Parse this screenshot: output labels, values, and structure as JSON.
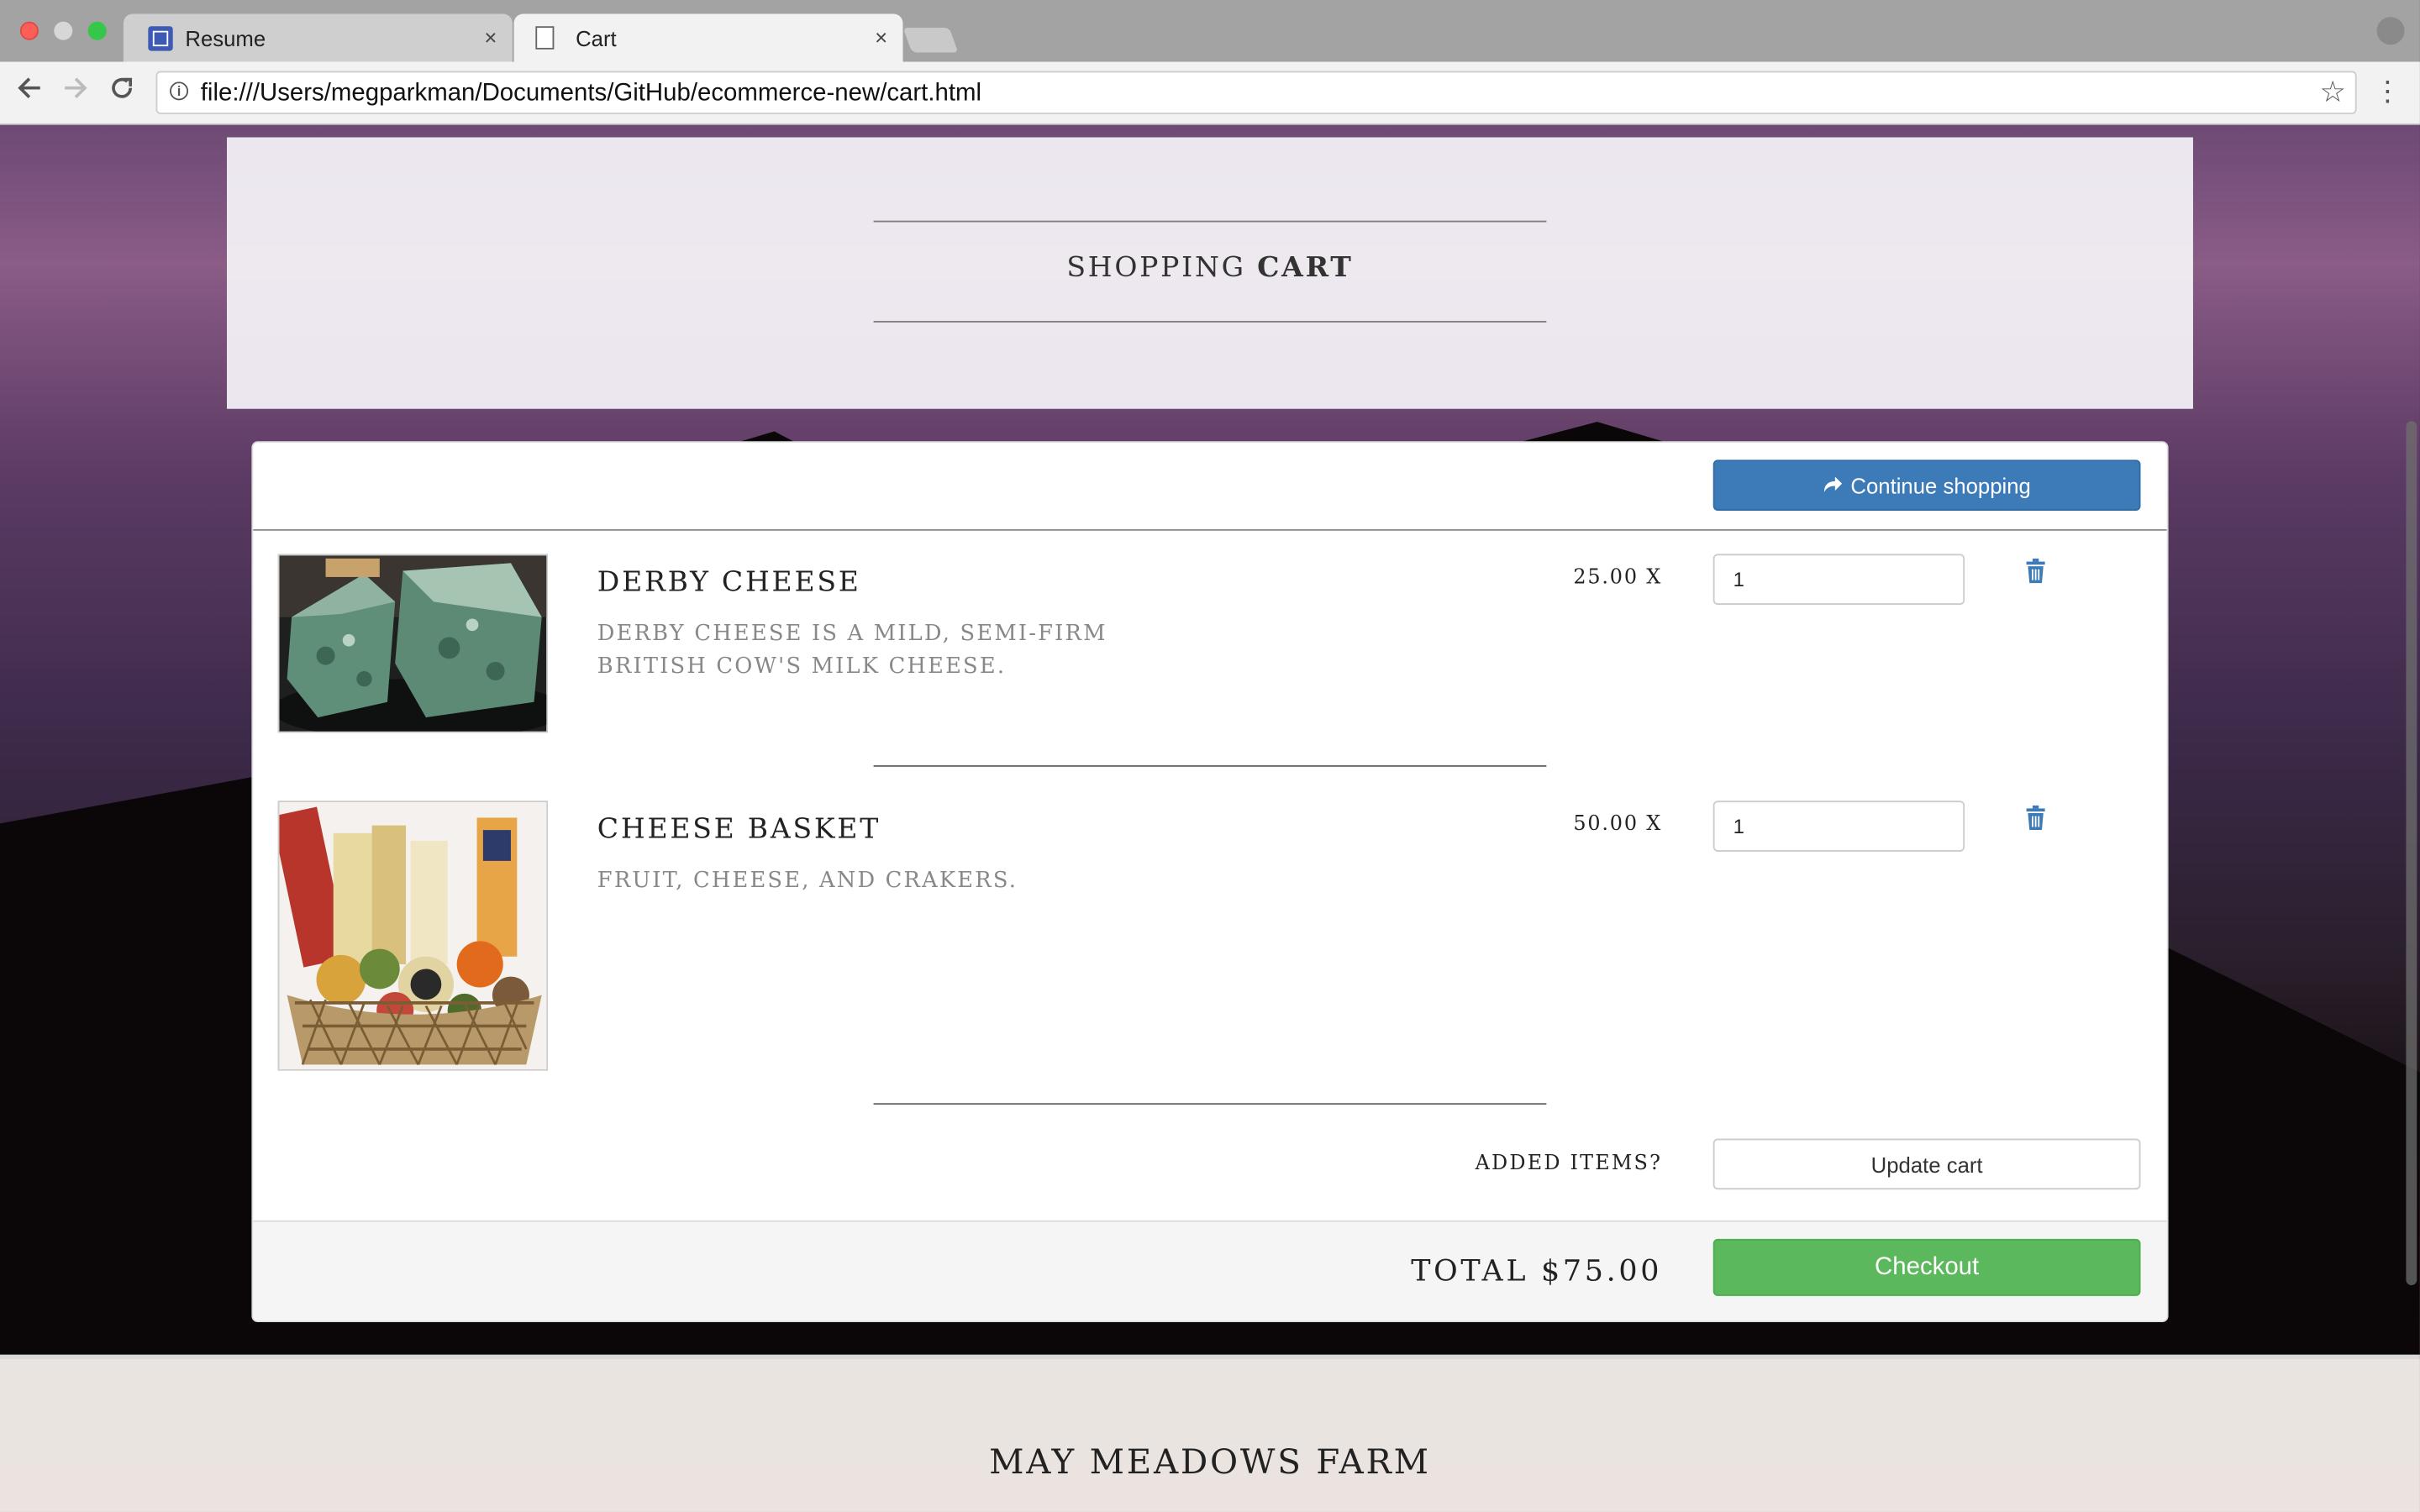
{
  "browser": {
    "tabs": [
      {
        "title": "Resume",
        "active": false
      },
      {
        "title": "Cart",
        "active": true
      }
    ],
    "tab_close_glyph": "×",
    "url": "file:///Users/megparkman/Documents/GitHub/ecommerce-new/cart.html"
  },
  "header": {
    "title_light": "SHOPPING ",
    "title_bold": "CART"
  },
  "cart": {
    "continue_label": "Continue shopping",
    "items": [
      {
        "name": "DERBY CHEESE",
        "description": "Derby cheese is a mild, semi-firm British cow's milk cheese.",
        "price": "25.00 X",
        "quantity": "1",
        "image": "derby-cheese-photo"
      },
      {
        "name": "CHEESE BASKET",
        "description": "Fruit, cheese, and crakers.",
        "price": "50.00 X",
        "quantity": "1",
        "image": "cheese-basket-photo"
      }
    ],
    "added_items_label": "ADDED ITEMS?",
    "update_label": "Update cart",
    "total_label": "TOTAL $75.00",
    "checkout_label": "Checkout"
  },
  "footer": {
    "title": "MAY MEADOWS FARM"
  },
  "colors": {
    "continue_button": "#3d7ab8",
    "checkout_button": "#5cb85c",
    "trash_icon": "#3d7ab8"
  }
}
